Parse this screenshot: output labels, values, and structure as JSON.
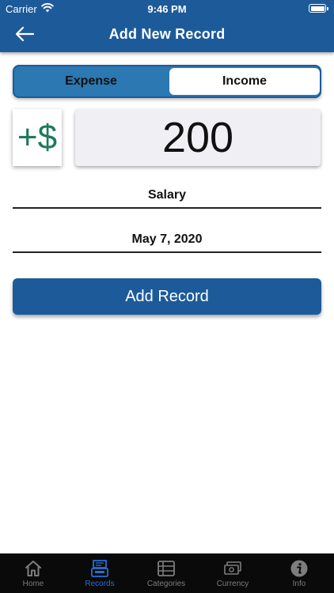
{
  "status_bar": {
    "carrier": "Carrier",
    "time": "9:46 PM",
    "battery_level": 1.0
  },
  "nav": {
    "title": "Add New Record",
    "back_icon": "arrow-left-icon"
  },
  "segment": {
    "options": [
      "Expense",
      "Income"
    ],
    "selected": "Income"
  },
  "amount": {
    "sign": "+$",
    "value": "200"
  },
  "fields": {
    "category": "Salary",
    "date": "May 7, 2020"
  },
  "actions": {
    "add_label": "Add Record"
  },
  "tabs": [
    {
      "label": "Home",
      "icon": "home-icon"
    },
    {
      "label": "Records",
      "icon": "records-icon"
    },
    {
      "label": "Categories",
      "icon": "categories-icon"
    },
    {
      "label": "Currency",
      "icon": "currency-icon"
    },
    {
      "label": "Info",
      "icon": "info-icon"
    }
  ],
  "active_tab": "Records",
  "colors": {
    "primary": "#1d5a9a",
    "segment_bg": "#2b78b2",
    "sign_green": "#1e7a5a",
    "tab_active": "#2a6fd0",
    "tab_inactive": "#7d7d7d",
    "tabbar_bg": "#0a0a0a"
  }
}
